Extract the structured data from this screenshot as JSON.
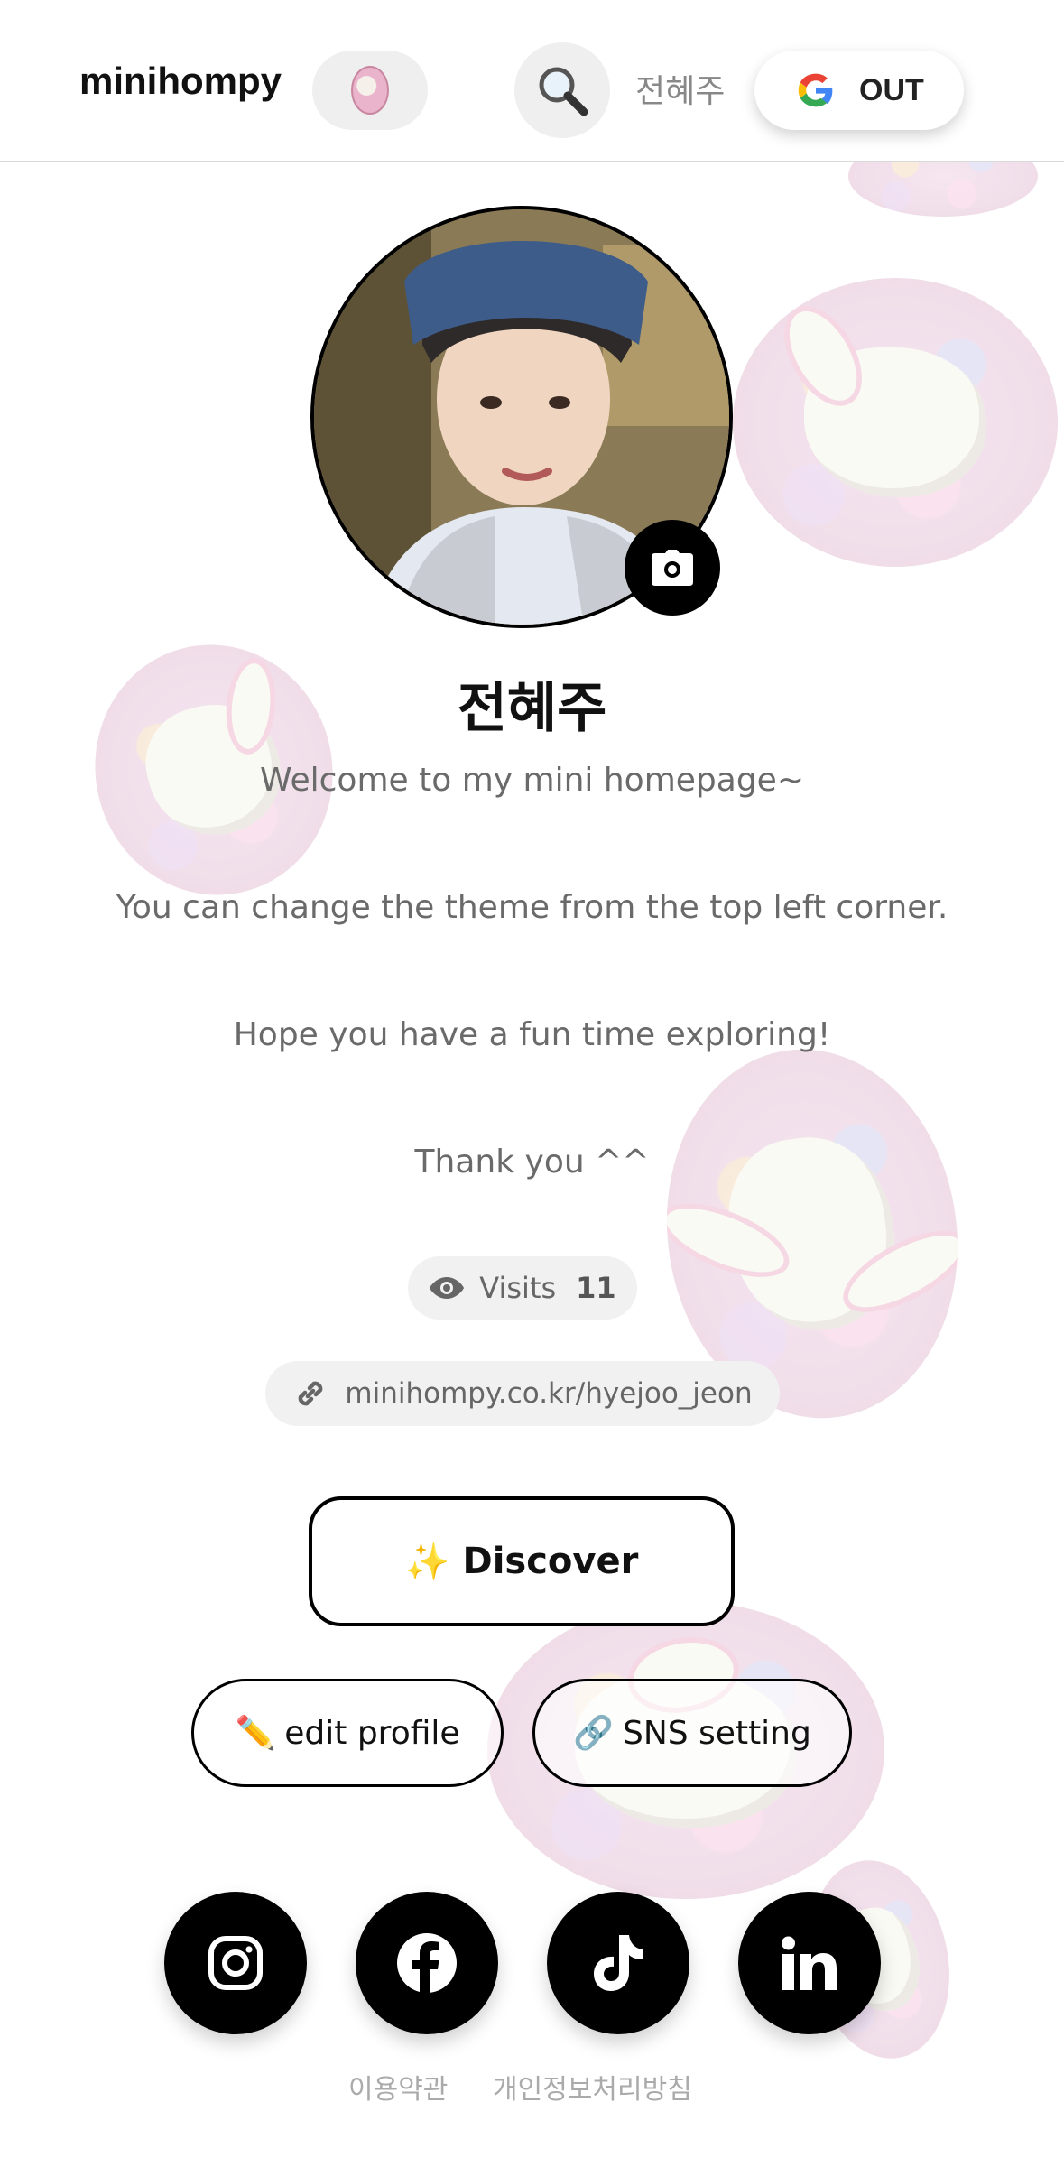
{
  "header": {
    "brand": "minihompy",
    "user_name": "전혜주",
    "logout_label": "OUT"
  },
  "profile": {
    "name": "전혜주",
    "bio_lines": [
      "Welcome to my mini homepage~",
      "You can change the theme from the top left corner.",
      "Hope you have a fun time exploring!",
      "Thank you ^^"
    ],
    "visits_label": "Visits",
    "visits_count": "11",
    "url": "minihompy.co.kr/hyejoo_jeon"
  },
  "actions": {
    "discover_emoji": "✨",
    "discover_label": "Discover",
    "edit_emoji": "✏️",
    "edit_label": "edit profile",
    "sns_emoji": "🔗",
    "sns_label": "SNS setting"
  },
  "social_links": [
    "instagram-icon",
    "facebook-icon",
    "tiktok-icon",
    "linkedin-icon"
  ],
  "footer": {
    "terms": "이용약관",
    "privacy": "개인정보처리방침"
  },
  "colors": {
    "accent": "#000000",
    "muted_text": "#6a6a6a",
    "pill_bg": "#f1f1f1"
  }
}
